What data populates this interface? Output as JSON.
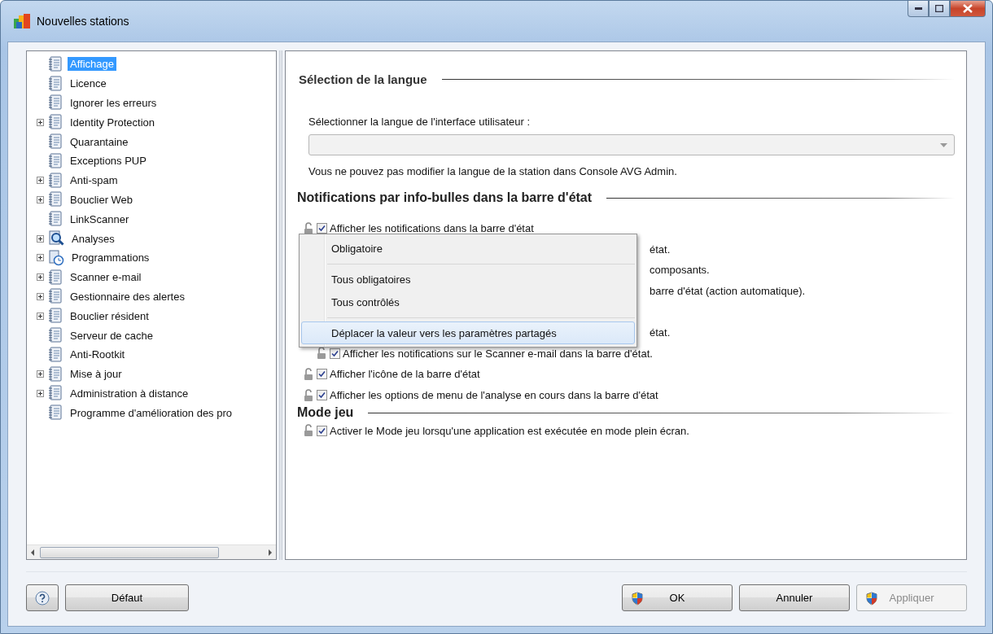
{
  "window": {
    "title": "Nouvelles stations"
  },
  "tree": {
    "items": [
      {
        "label": "Affichage",
        "kind": "doc",
        "expandable": false,
        "selected": true
      },
      {
        "label": "Licence",
        "kind": "doc",
        "expandable": false,
        "selected": false
      },
      {
        "label": "Ignorer les erreurs",
        "kind": "doc",
        "expandable": false,
        "selected": false
      },
      {
        "label": "Identity Protection",
        "kind": "doc",
        "expandable": true,
        "selected": false
      },
      {
        "label": "Quarantaine",
        "kind": "doc",
        "expandable": false,
        "selected": false
      },
      {
        "label": "Exceptions PUP",
        "kind": "doc",
        "expandable": false,
        "selected": false
      },
      {
        "label": "Anti-spam",
        "kind": "doc",
        "expandable": true,
        "selected": false
      },
      {
        "label": "Bouclier Web",
        "kind": "doc",
        "expandable": true,
        "selected": false
      },
      {
        "label": "LinkScanner",
        "kind": "doc",
        "expandable": false,
        "selected": false
      },
      {
        "label": "Analyses",
        "kind": "search",
        "expandable": true,
        "selected": false
      },
      {
        "label": "Programmations",
        "kind": "schedule",
        "expandable": true,
        "selected": false
      },
      {
        "label": "Scanner e-mail",
        "kind": "doc",
        "expandable": true,
        "selected": false
      },
      {
        "label": "Gestionnaire des alertes",
        "kind": "doc",
        "expandable": true,
        "selected": false
      },
      {
        "label": "Bouclier résident",
        "kind": "doc",
        "expandable": true,
        "selected": false
      },
      {
        "label": "Serveur de cache",
        "kind": "doc",
        "expandable": false,
        "selected": false
      },
      {
        "label": "Anti-Rootkit",
        "kind": "doc",
        "expandable": false,
        "selected": false
      },
      {
        "label": "Mise à jour",
        "kind": "doc",
        "expandable": true,
        "selected": false
      },
      {
        "label": "Administration à distance",
        "kind": "doc",
        "expandable": true,
        "selected": false
      },
      {
        "label": "Programme d'amélioration des pro",
        "kind": "doc",
        "expandable": false,
        "selected": false
      }
    ]
  },
  "language_section": {
    "title": "Sélection de la langue",
    "field_label": "Sélectionner la langue de l'interface utilisateur :",
    "note": "Vous ne pouvez pas modifier la langue de la station dans Console AVG Admin."
  },
  "notifications_section": {
    "title": "Notifications par info-bulles dans la barre d'état",
    "options": [
      {
        "kind": "option",
        "label": "Afficher les notifications dans la barre d'état",
        "checked": true,
        "indented": false
      },
      {
        "kind": "fragment",
        "label": "état."
      },
      {
        "kind": "fragment",
        "label": "composants."
      },
      {
        "kind": "fragment",
        "label": "barre d'état (action automatique)."
      },
      {
        "kind": "hidden"
      },
      {
        "kind": "fragment",
        "label": "état."
      },
      {
        "kind": "option",
        "label": "Afficher les notifications sur le Scanner e-mail dans la barre d'état.",
        "checked": true,
        "indented": true
      },
      {
        "kind": "option",
        "label": "Afficher l'icône de la barre d'état",
        "checked": true,
        "indented": false
      },
      {
        "kind": "option",
        "label": "Afficher les options de menu de l'analyse en cours dans la barre d'état",
        "checked": true,
        "indented": false
      }
    ]
  },
  "game_section": {
    "title": "Mode jeu",
    "options": [
      {
        "kind": "option",
        "label": "Activer le Mode jeu lorsqu'une application est exécutée en mode plein écran.",
        "checked": true
      }
    ]
  },
  "context_menu": {
    "items": [
      {
        "kind": "item",
        "label": "Obligatoire",
        "selected": false
      },
      {
        "kind": "separator"
      },
      {
        "kind": "item",
        "label": "Tous obligatoires",
        "selected": false
      },
      {
        "kind": "item",
        "label": "Tous contrôlés",
        "selected": false
      },
      {
        "kind": "separator"
      },
      {
        "kind": "item",
        "label": "Déplacer la valeur vers les paramètres partagés",
        "selected": true
      }
    ]
  },
  "buttons": {
    "default": "Défaut",
    "ok": "OK",
    "cancel": "Annuler",
    "apply": "Appliquer",
    "apply_disabled": true
  }
}
